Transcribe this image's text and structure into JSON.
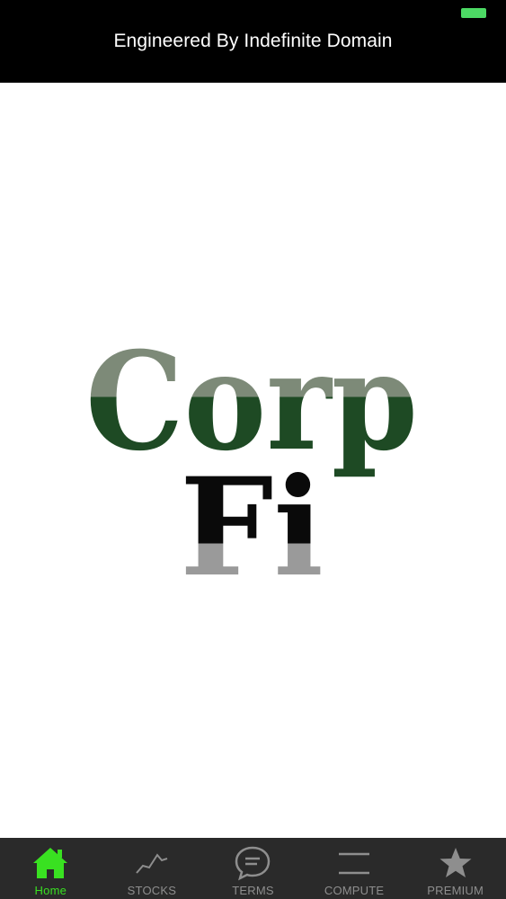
{
  "header": {
    "title": "Engineered By Indefinite Domain",
    "battery_color": "#4cd964"
  },
  "logo": {
    "line1": "Corp",
    "line2": "Fi",
    "colors": {
      "green_dark": "#1e4a24",
      "green_light": "#7d8a78",
      "black": "#0a0a0a",
      "gray": "#9a9a9a"
    }
  },
  "tabs": [
    {
      "label": "Home",
      "icon": "house-icon",
      "active": true
    },
    {
      "label": "STOCKS",
      "icon": "trend-line-icon",
      "active": false
    },
    {
      "label": "TERMS",
      "icon": "speech-bubble-icon",
      "active": false
    },
    {
      "label": "COMPUTE",
      "icon": "menu-lines-icon",
      "active": false
    },
    {
      "label": "PREMIUM",
      "icon": "star-icon",
      "active": false
    }
  ],
  "colors": {
    "tab_active": "#39e121",
    "tab_inactive": "#8e8e8e",
    "tab_bar_bg": "#2a2a2a"
  }
}
